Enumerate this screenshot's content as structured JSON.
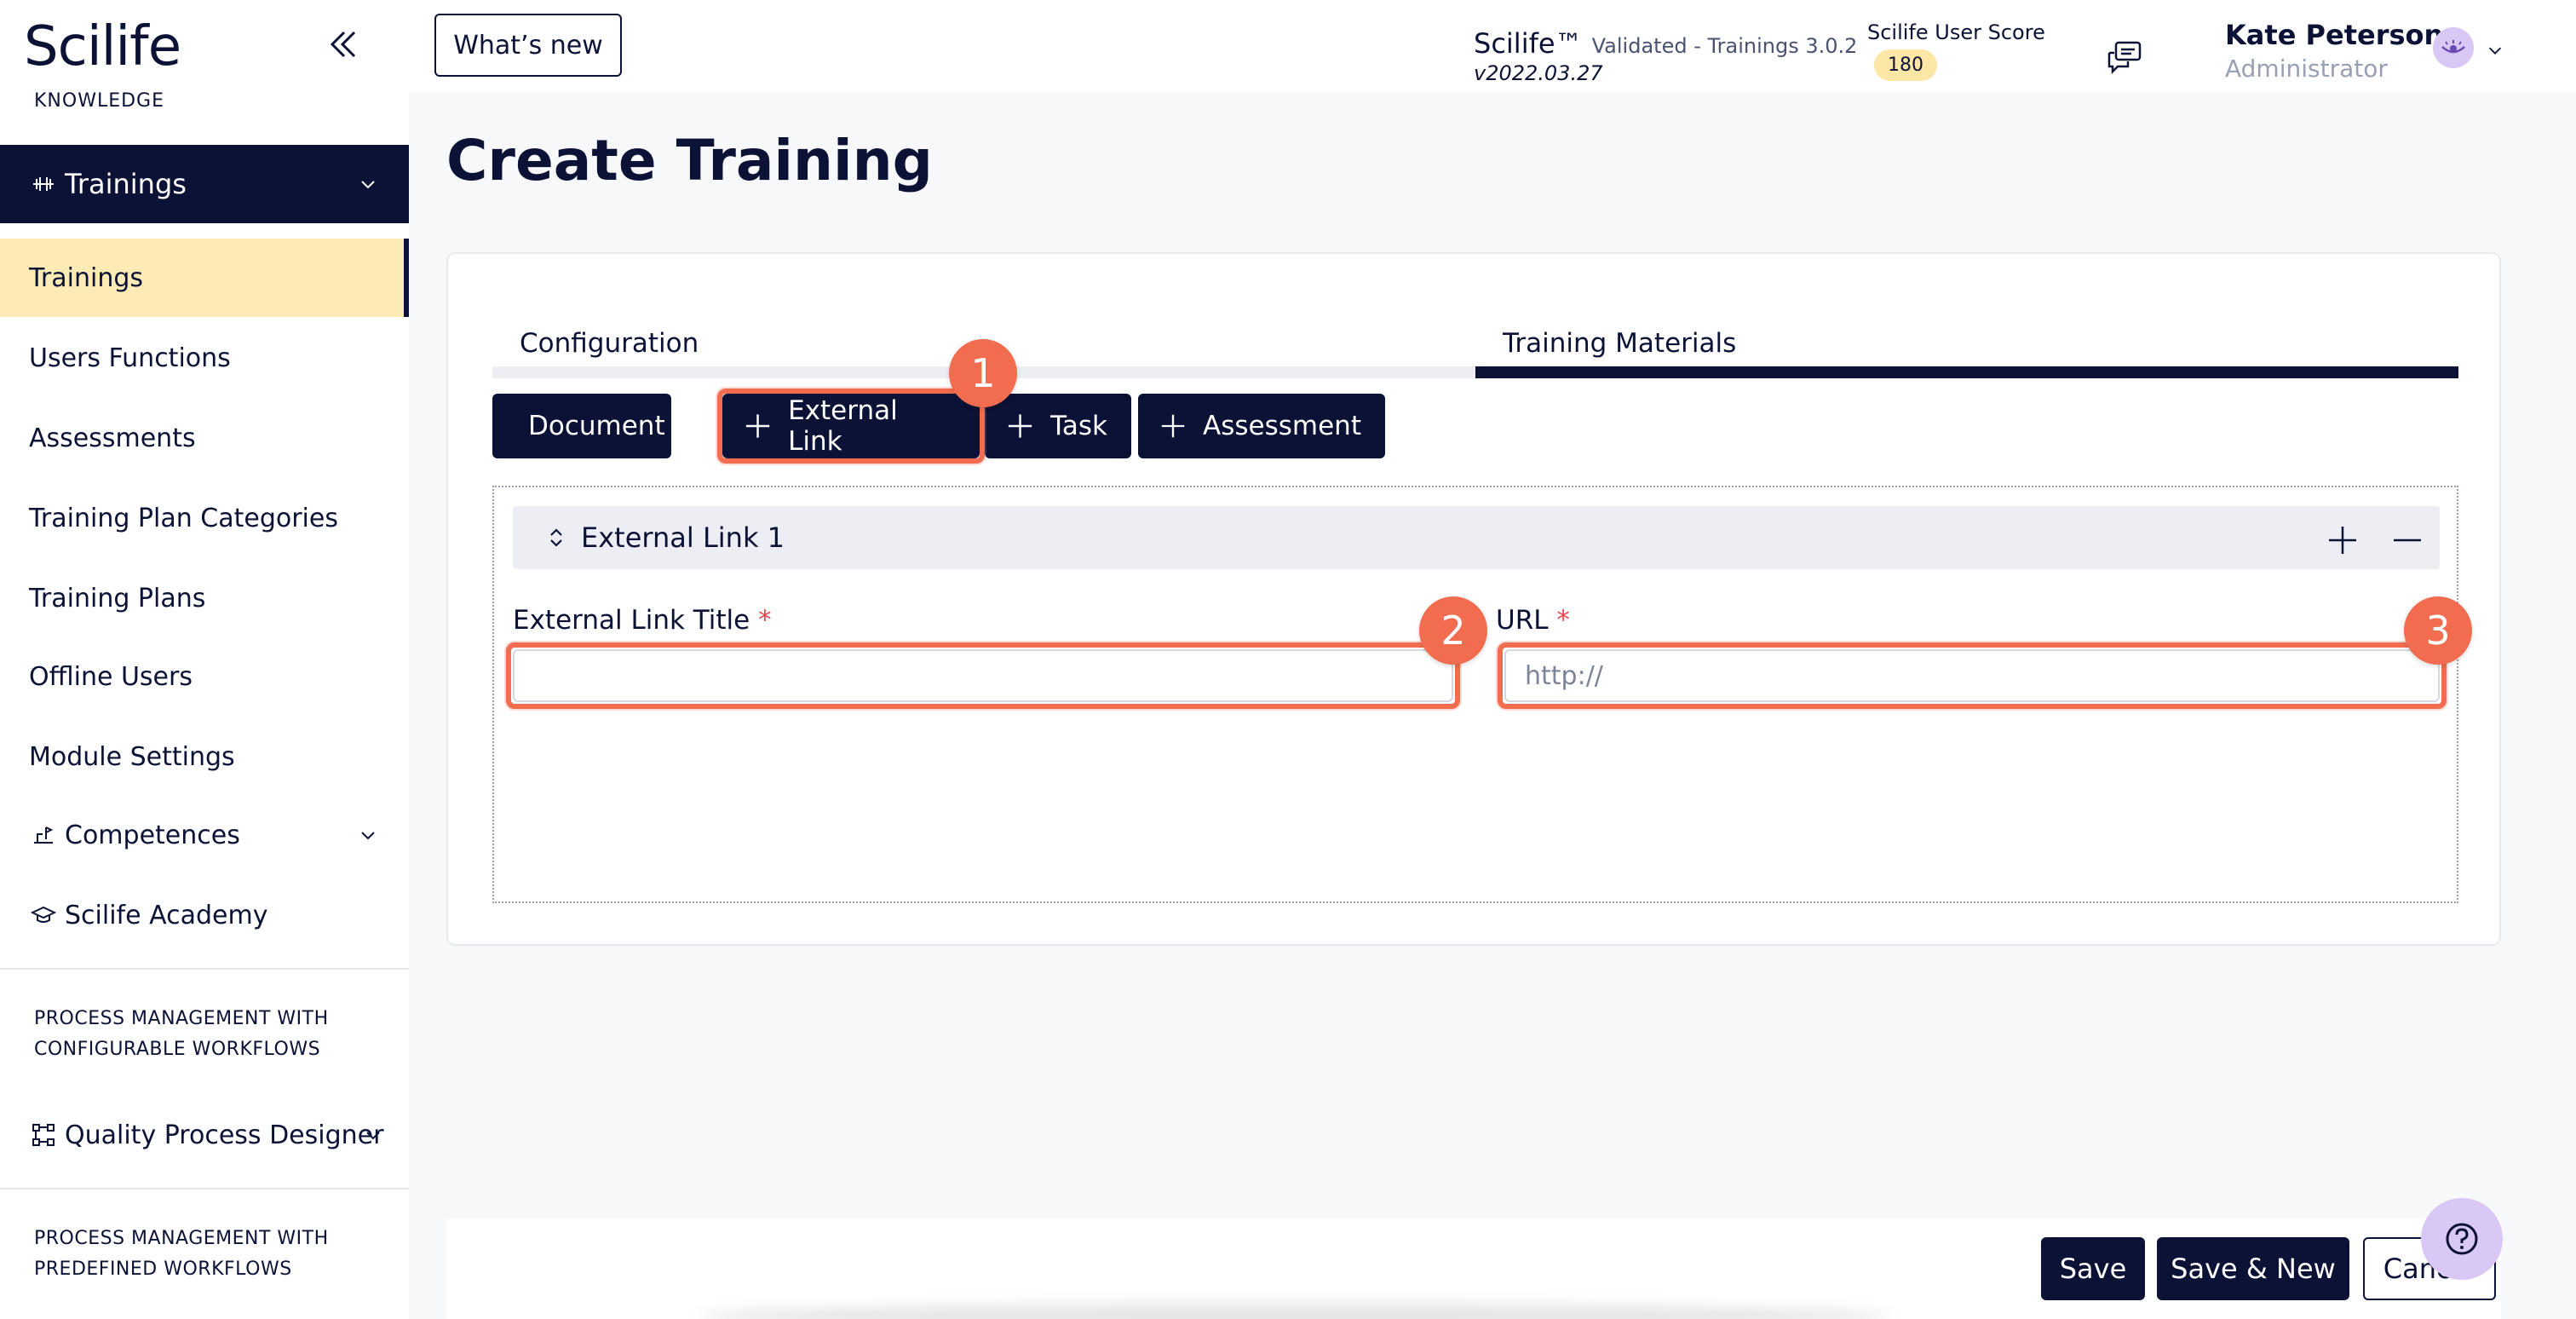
{
  "sidebar": {
    "logo": "Scilife",
    "logo_sub": "KNOWLEDGE",
    "group_head": "Trainings",
    "items": [
      {
        "label": "Trainings"
      },
      {
        "label": "Users Functions"
      },
      {
        "label": "Assessments"
      },
      {
        "label": "Training Plan Categories"
      },
      {
        "label": "Training Plans"
      },
      {
        "label": "Offline Users"
      },
      {
        "label": "Module Settings"
      }
    ],
    "competences": "Competences",
    "academy": "Scilife Academy",
    "section1": "PROCESS MANAGEMENT WITH CONFIGURABLE WORKFLOWS",
    "quality_designer": "Quality Process Designer",
    "section2": "PROCESS MANAGEMENT WITH PREDEFINED WORKFLOWS"
  },
  "topbar": {
    "whats_new": "What’s new",
    "brand": "Scilife™",
    "validated": "Validated - Trainings 3.0.2",
    "version": "v2022.03.27",
    "score_label": "Scilife User Score",
    "score_value": "180",
    "user_name": "Kate Peterson",
    "user_role": "Administrator"
  },
  "main": {
    "title": "Create Training",
    "tabs": [
      {
        "label": "Configuration"
      },
      {
        "label": "Training Materials"
      }
    ],
    "add_buttons": [
      {
        "label": "Document"
      },
      {
        "label": "External Link"
      },
      {
        "label": "Task"
      },
      {
        "label": "Assessment"
      }
    ],
    "accordion_title": "External Link 1",
    "fields": {
      "title_label": "External Link Title",
      "title_value": "",
      "url_label": "URL",
      "url_placeholder": "http://",
      "required_mark": "*"
    },
    "markers": [
      "1",
      "2",
      "3"
    ]
  },
  "footer": {
    "save": "Save",
    "save_new": "Save & New",
    "cancel": "Cancel"
  },
  "colors": {
    "navy": "#0b1236",
    "highlight": "#f26c4f",
    "active_item": "#fdebb6",
    "badge": "#fde7a6"
  }
}
